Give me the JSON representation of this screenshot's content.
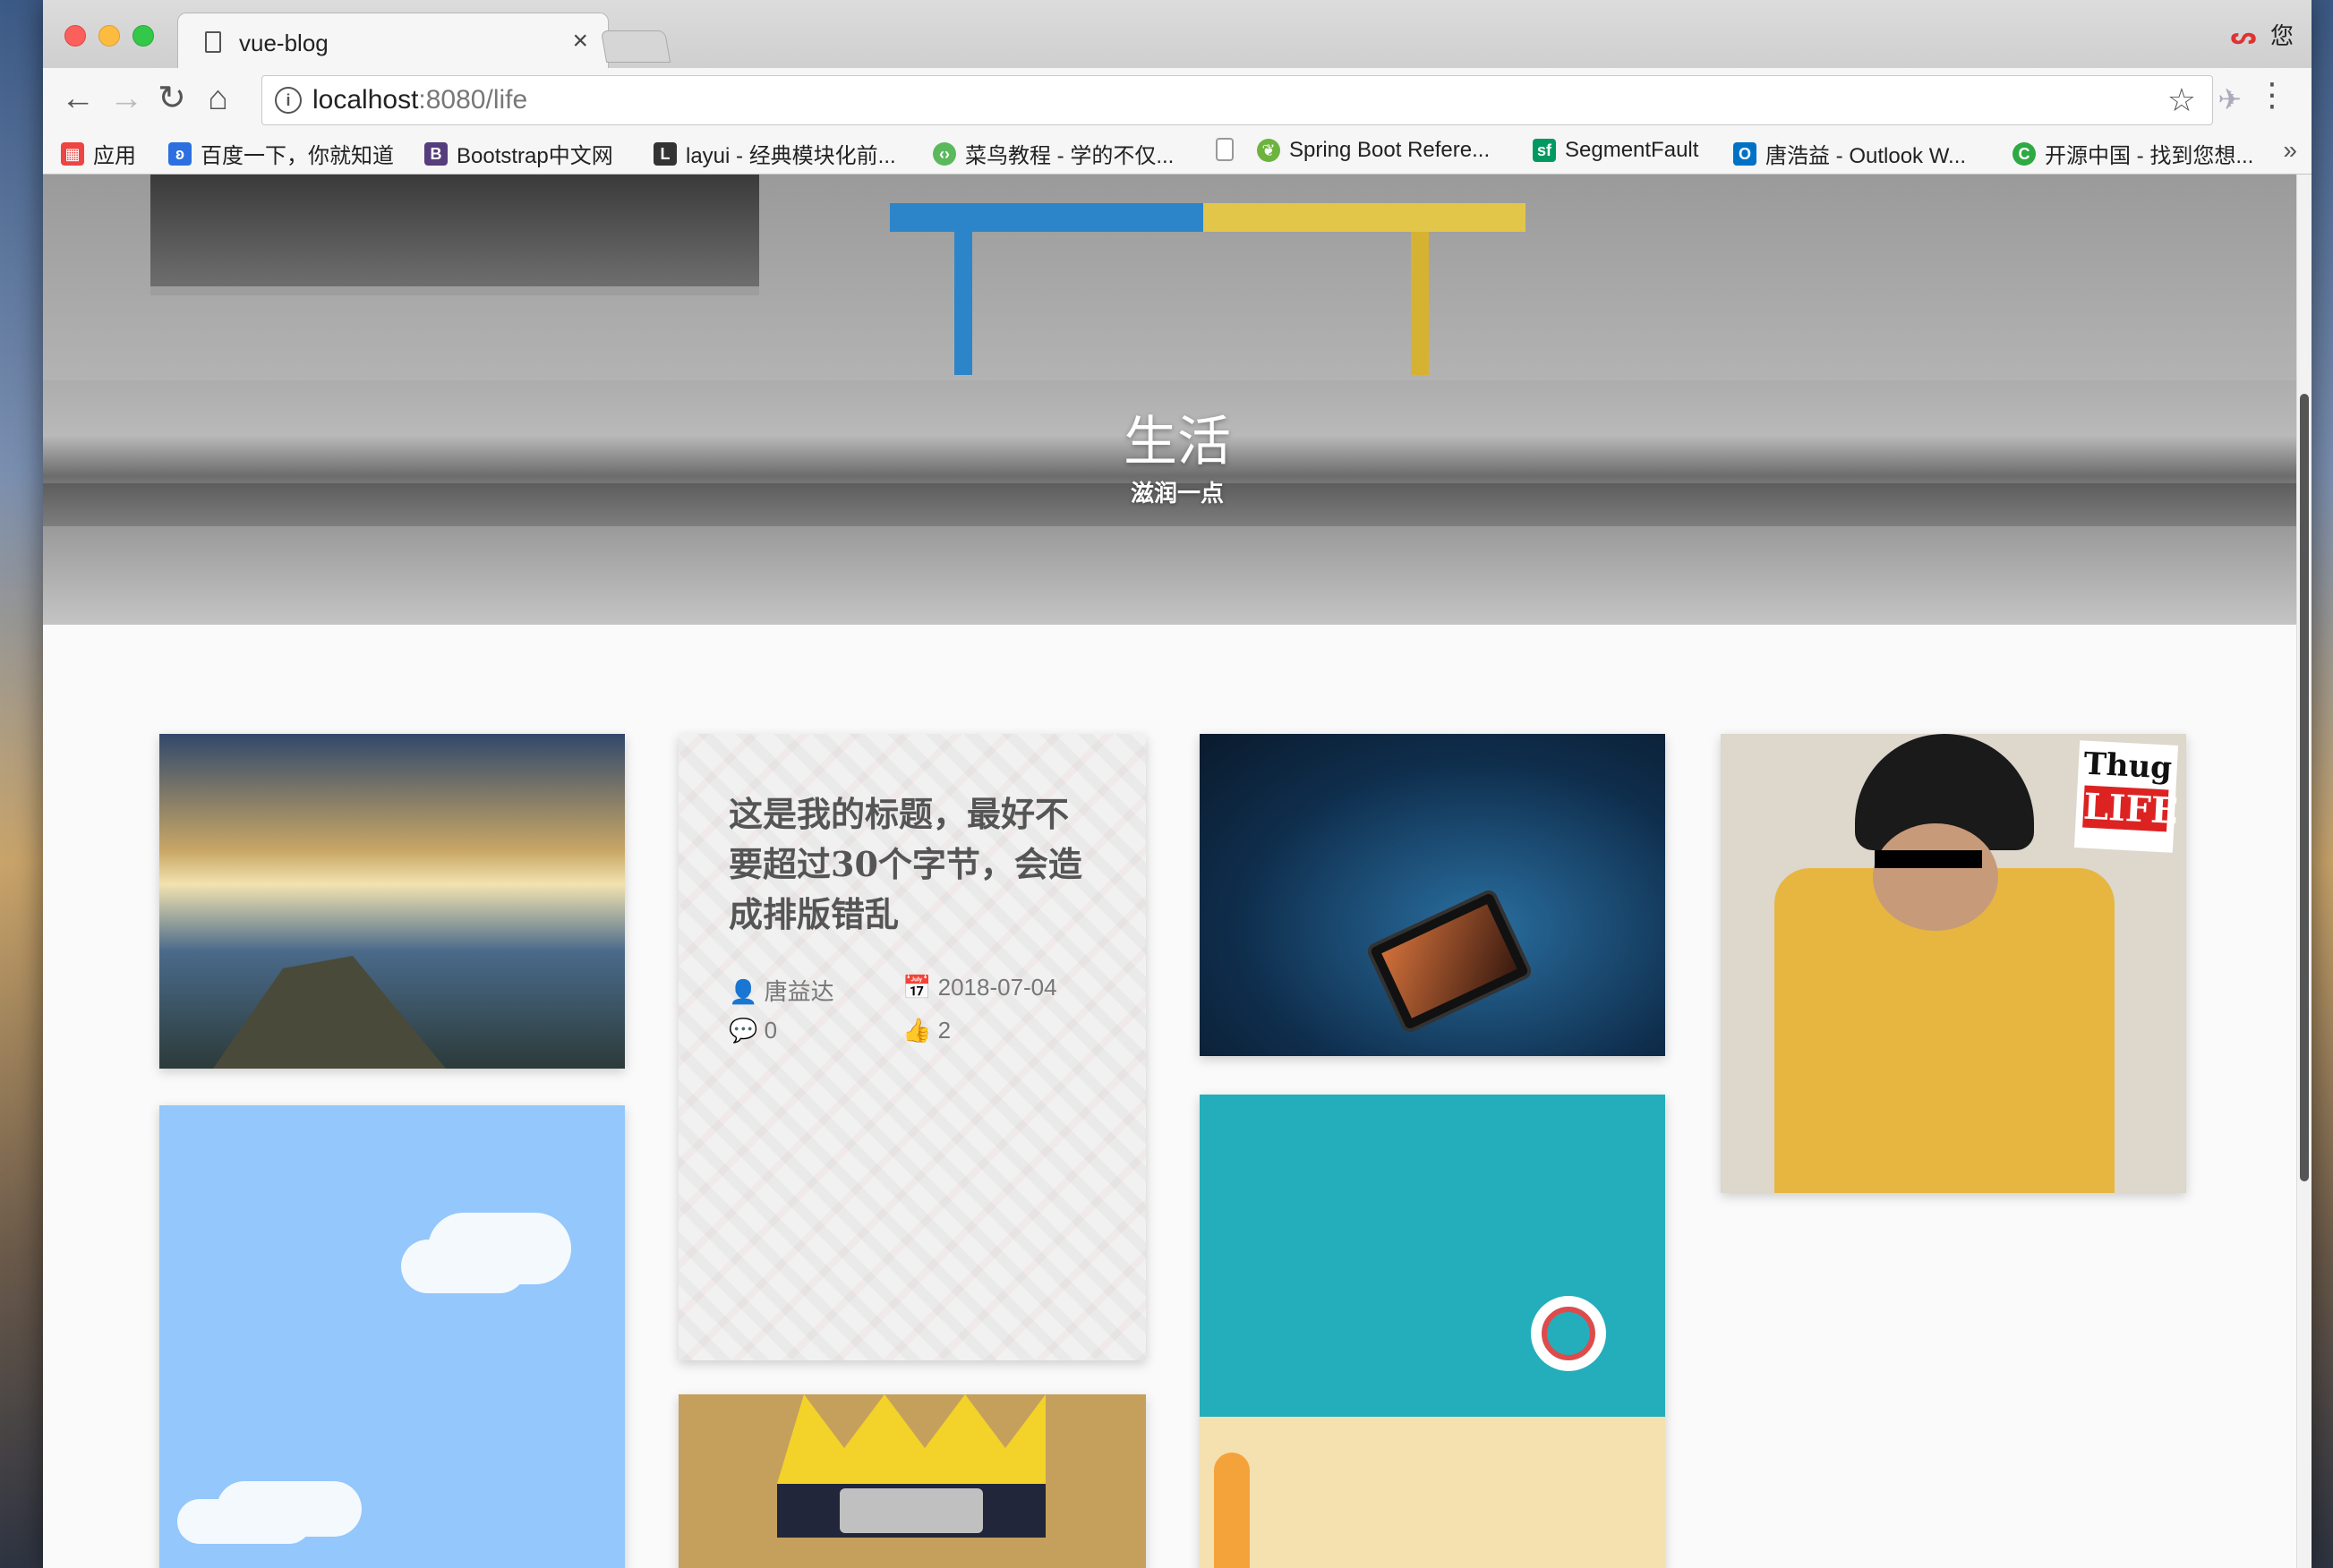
{
  "tab": {
    "title": "vue-blog",
    "close": "×"
  },
  "profile": {
    "icon": "ᔕ",
    "label": "您"
  },
  "address": {
    "host": "localhost",
    "path": ":8080/life"
  },
  "bookmarks": [
    {
      "label": "应用",
      "icon": "apps-icon",
      "color": "#e44"
    },
    {
      "label": "百度一下，你就知道",
      "icon": "baidu-icon",
      "color": "#2c6fe0"
    },
    {
      "label": "Bootstrap中文网",
      "icon": "bootstrap-icon",
      "color": "#563d7c"
    },
    {
      "label": "layui - 经典模块化前...",
      "icon": "layui-icon",
      "color": "#333"
    },
    {
      "label": "菜鸟教程 - 学的不仅...",
      "icon": "runoob-icon",
      "color": "#5cb85c"
    },
    {
      "label": "",
      "icon": "page-icon",
      "color": "#999"
    },
    {
      "label": "Spring Boot Refere...",
      "icon": "spring-icon",
      "color": "#6db33f"
    },
    {
      "label": "SegmentFault",
      "icon": "segmentfault-icon",
      "color": "#009a61"
    },
    {
      "label": "唐浩益 - Outlook W...",
      "icon": "outlook-icon",
      "color": "#0072c6"
    },
    {
      "label": "开源中国 - 找到您想...",
      "icon": "oschina-icon",
      "color": "#2fa944"
    }
  ],
  "hero": {
    "title": "生活",
    "subtitle": "滋润一点"
  },
  "post": {
    "title": "这是我的标题，最好不要超过30个字节，会造成排版错乱",
    "author": "唐益达",
    "date": "2018-07-04",
    "comments": "0",
    "likes": "2"
  },
  "thug_sticker": {
    "line1": "Thug",
    "line2": "LIFE"
  },
  "colors": {
    "accent_blue": "#2d85c9",
    "bench_yellow": "#e1c64a",
    "sky": "#94c7fb",
    "sea": "#24adbb"
  }
}
